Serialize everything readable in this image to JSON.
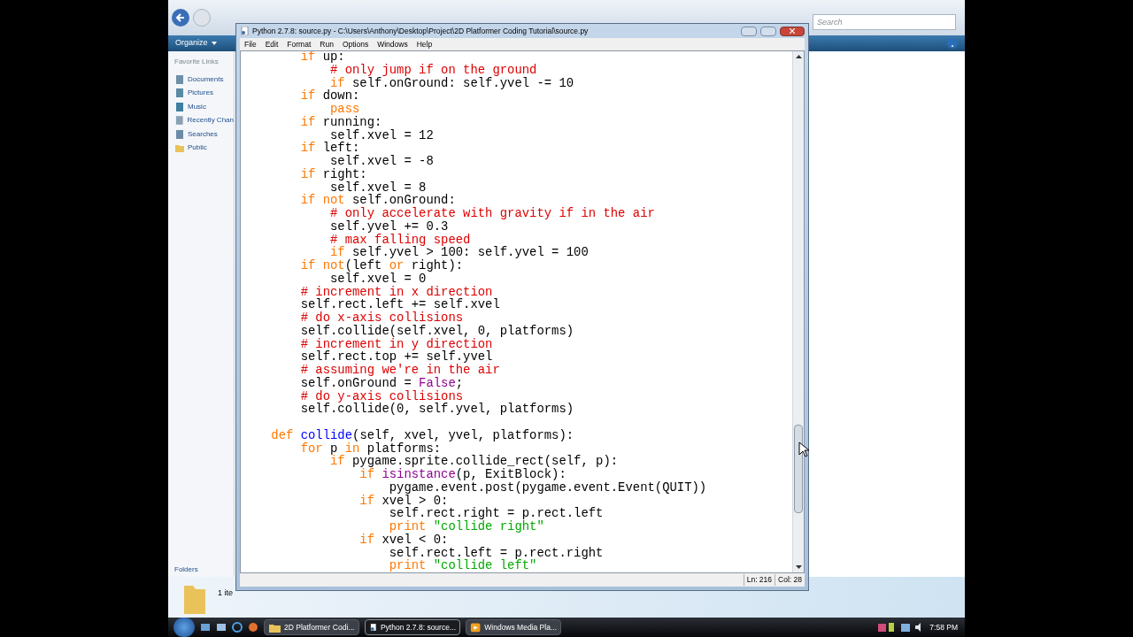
{
  "explorer": {
    "search": {
      "placeholder": "Search"
    },
    "toolbar": {
      "organize": "Organize"
    },
    "sidebar": {
      "header": "Favorite Links",
      "items": [
        {
          "label": "Documents",
          "kind": "docs"
        },
        {
          "label": "Pictures",
          "kind": "pics"
        },
        {
          "label": "Music",
          "kind": "music"
        },
        {
          "label": "Recently Chan",
          "kind": "recent"
        },
        {
          "label": "Searches",
          "kind": "search"
        },
        {
          "label": "Public",
          "kind": "folder"
        }
      ],
      "folders": "Folders"
    },
    "details": {
      "count": "1 ite"
    }
  },
  "editor": {
    "title": "Python 2.7.8: source.py - C:\\Users\\Anthony\\Desktop\\Project\\2D Platformer Coding Tutorial\\source.py",
    "menu": [
      "File",
      "Edit",
      "Format",
      "Run",
      "Options",
      "Windows",
      "Help"
    ],
    "code_lines": [
      {
        "tokens": [
          {
            "kind": "kw",
            "text": "        if"
          },
          {
            "kind": "pl",
            "text": " up:"
          }
        ]
      },
      {
        "tokens": [
          {
            "kind": "cm",
            "text": "            # only jump if on the ground"
          }
        ]
      },
      {
        "tokens": [
          {
            "kind": "kw",
            "text": "            if"
          },
          {
            "kind": "pl",
            "text": " self.onGround: self.yvel -= 10"
          }
        ]
      },
      {
        "tokens": [
          {
            "kind": "kw",
            "text": "        if"
          },
          {
            "kind": "pl",
            "text": " down:"
          }
        ]
      },
      {
        "tokens": [
          {
            "kind": "kw",
            "text": "            pass"
          }
        ]
      },
      {
        "tokens": [
          {
            "kind": "kw",
            "text": "        if"
          },
          {
            "kind": "pl",
            "text": " running:"
          }
        ]
      },
      {
        "tokens": [
          {
            "kind": "pl",
            "text": "            self.xvel = 12"
          }
        ]
      },
      {
        "tokens": [
          {
            "kind": "kw",
            "text": "        if"
          },
          {
            "kind": "pl",
            "text": " left:"
          }
        ]
      },
      {
        "tokens": [
          {
            "kind": "pl",
            "text": "            self.xvel = -8"
          }
        ]
      },
      {
        "tokens": [
          {
            "kind": "kw",
            "text": "        if"
          },
          {
            "kind": "pl",
            "text": " right:"
          }
        ]
      },
      {
        "tokens": [
          {
            "kind": "pl",
            "text": "            self.xvel = 8"
          }
        ]
      },
      {
        "tokens": [
          {
            "kind": "kw",
            "text": "        if not"
          },
          {
            "kind": "pl",
            "text": " self.onGround:"
          }
        ]
      },
      {
        "tokens": [
          {
            "kind": "cm",
            "text": "            # only accelerate with gravity if in the air"
          }
        ]
      },
      {
        "tokens": [
          {
            "kind": "pl",
            "text": "            self.yvel += 0.3"
          }
        ]
      },
      {
        "tokens": [
          {
            "kind": "cm",
            "text": "            # max falling speed"
          }
        ]
      },
      {
        "tokens": [
          {
            "kind": "kw",
            "text": "            if"
          },
          {
            "kind": "pl",
            "text": " self.yvel > 100: self.yvel = 100"
          }
        ]
      },
      {
        "tokens": [
          {
            "kind": "kw",
            "text": "        if not"
          },
          {
            "kind": "pl",
            "text": "(left "
          },
          {
            "kind": "kw",
            "text": "or"
          },
          {
            "kind": "pl",
            "text": " right):"
          }
        ]
      },
      {
        "tokens": [
          {
            "kind": "pl",
            "text": "            self.xvel = 0"
          }
        ]
      },
      {
        "tokens": [
          {
            "kind": "cm",
            "text": "        # increment in x direction"
          }
        ]
      },
      {
        "tokens": [
          {
            "kind": "pl",
            "text": "        self.rect.left += self.xvel"
          }
        ]
      },
      {
        "tokens": [
          {
            "kind": "cm",
            "text": "        # do x-axis collisions"
          }
        ]
      },
      {
        "tokens": [
          {
            "kind": "pl",
            "text": "        self.collide(self.xvel, 0, platforms)"
          }
        ]
      },
      {
        "tokens": [
          {
            "kind": "cm",
            "text": "        # increment in y direction"
          }
        ]
      },
      {
        "tokens": [
          {
            "kind": "pl",
            "text": "        self.rect.top += self.yvel"
          }
        ]
      },
      {
        "tokens": [
          {
            "kind": "cm",
            "text": "        # assuming we're in the air"
          }
        ]
      },
      {
        "tokens": [
          {
            "kind": "pl",
            "text": "        self.onGround = "
          },
          {
            "kind": "bi",
            "text": "False"
          },
          {
            "kind": "pl",
            "text": ";"
          }
        ]
      },
      {
        "tokens": [
          {
            "kind": "cm",
            "text": "        # do y-axis collisions"
          }
        ]
      },
      {
        "tokens": [
          {
            "kind": "pl",
            "text": "        self.collide(0, self.yvel, platforms)"
          }
        ]
      },
      {
        "blank_line_before": true,
        "tokens": [
          {
            "kind": "kw",
            "text": "    def"
          },
          {
            "kind": "fn",
            "text": " collide"
          },
          {
            "kind": "pl",
            "text": "(self, xvel, yvel, platforms):"
          }
        ]
      },
      {
        "tokens": [
          {
            "kind": "kw",
            "text": "        for"
          },
          {
            "kind": "pl",
            "text": " p "
          },
          {
            "kind": "kw",
            "text": "in"
          },
          {
            "kind": "pl",
            "text": " platforms:"
          }
        ]
      },
      {
        "tokens": [
          {
            "kind": "kw",
            "text": "            if"
          },
          {
            "kind": "pl",
            "text": " pygame.sprite.collide_rect(self, p):"
          }
        ]
      },
      {
        "tokens": [
          {
            "kind": "kw",
            "text": "                if"
          },
          {
            "kind": "bi",
            "text": " isinstance"
          },
          {
            "kind": "pl",
            "text": "(p, ExitBlock):"
          }
        ]
      },
      {
        "tokens": [
          {
            "kind": "pl",
            "text": "                    pygame.event.post(pygame.event.Event(QUIT))"
          }
        ]
      },
      {
        "tokens": [
          {
            "kind": "kw",
            "text": "                if"
          },
          {
            "kind": "pl",
            "text": " xvel > 0:"
          }
        ]
      },
      {
        "tokens": [
          {
            "kind": "pl",
            "text": "                    self.rect.right = p.rect.left"
          }
        ]
      },
      {
        "tokens": [
          {
            "kind": "kw",
            "text": "                    print"
          },
          {
            "kind": "str",
            "text": " \"collide right\""
          }
        ]
      },
      {
        "tokens": [
          {
            "kind": "kw",
            "text": "                if"
          },
          {
            "kind": "pl",
            "text": " xvel < 0:"
          }
        ]
      },
      {
        "tokens": [
          {
            "kind": "pl",
            "text": "                    self.rect.left = p.rect.right"
          }
        ]
      },
      {
        "tokens": [
          {
            "kind": "kw",
            "text": "                    print"
          },
          {
            "kind": "str",
            "text": " \"collide left\""
          }
        ]
      }
    ],
    "status": {
      "line": "Ln: 216",
      "col": "Col: 28"
    }
  },
  "taskbar": {
    "tasks": [
      {
        "label": "2D Platformer Codi...",
        "kind": "folder",
        "selected": false
      },
      {
        "label": "Python 2.7.8: source...",
        "kind": "python",
        "selected": true
      },
      {
        "label": "Windows Media Pla...",
        "kind": "media",
        "selected": false
      }
    ],
    "clock": "7:58 PM"
  }
}
